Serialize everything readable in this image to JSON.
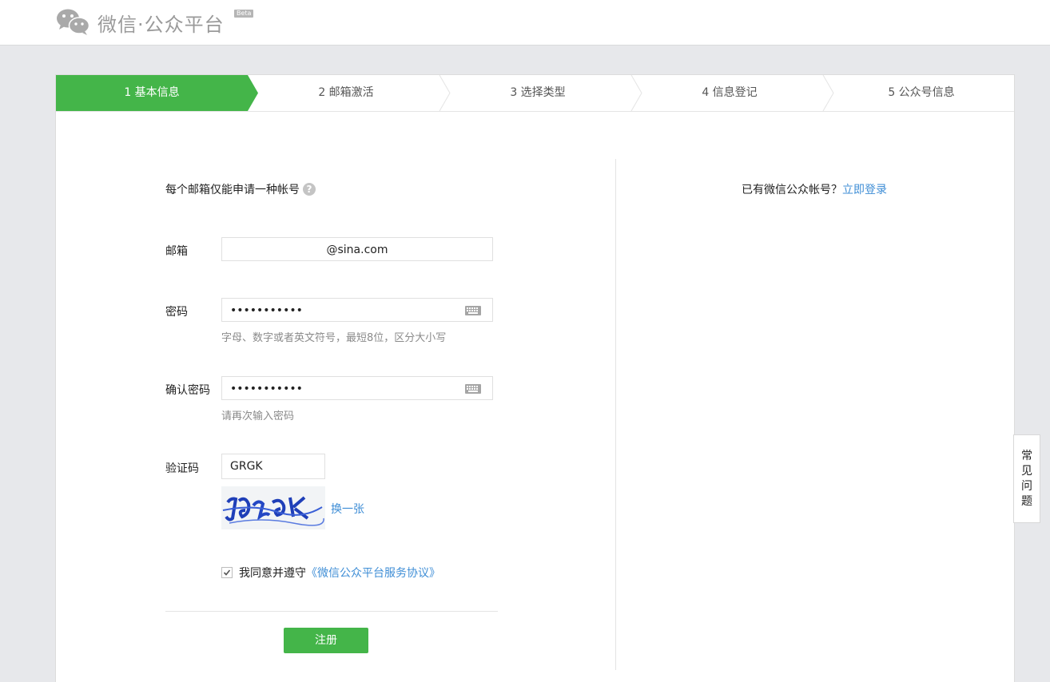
{
  "header": {
    "brand": "微信·公众平台",
    "badge": "Beta"
  },
  "steps": [
    {
      "label": "1 基本信息"
    },
    {
      "label": "2 邮箱激活"
    },
    {
      "label": "3 选择类型"
    },
    {
      "label": "4 信息登记"
    },
    {
      "label": "5 公众号信息"
    }
  ],
  "form": {
    "notice": "每个邮箱仅能申请一种帐号",
    "email_label": "邮箱",
    "email_value": "@sina.com",
    "password_label": "密码",
    "password_value": "•••••••••••",
    "password_hint": "字母、数字或者英文符号，最短8位，区分大小写",
    "confirm_label": "确认密码",
    "confirm_value": "•••••••••••",
    "confirm_hint": "请再次输入密码",
    "captcha_label": "验证码",
    "captcha_value": "GRGK",
    "refresh_link": "换一张",
    "agree_text": "我同意并遵守",
    "agreement_link": "《微信公众平台服务协议》",
    "submit_label": "注册"
  },
  "side": {
    "login_prompt": "已有微信公众帐号？",
    "login_link": "立即登录"
  },
  "faq_label": "常见问题",
  "colors": {
    "accent": "#44b549",
    "link": "#3f8ed6"
  }
}
